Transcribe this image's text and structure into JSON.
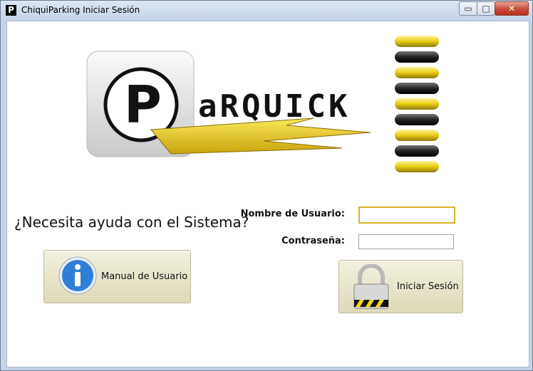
{
  "window": {
    "title": "ChiquiParking Iniciar Sesión",
    "app_icon_glyph": "P"
  },
  "controls": {
    "minimize": "▭",
    "maximize": "□",
    "close": "✕"
  },
  "logo": {
    "letter": "P",
    "wordmark": "aRQUICK",
    "brand_colors": {
      "yellow": "#f2d716",
      "dark": "#1a1a1a"
    }
  },
  "help": {
    "question": "¿Necesita ayuda con el Sistema?",
    "manual_button": "Manual de Usuario",
    "manual_icon": "info-icon"
  },
  "login": {
    "username_label": "Nombre de Usuario:",
    "username_value": "",
    "password_label": "Contraseña:",
    "password_value": "",
    "submit_button": "Iniciar Sesión",
    "submit_icon": "padlock-icon"
  }
}
